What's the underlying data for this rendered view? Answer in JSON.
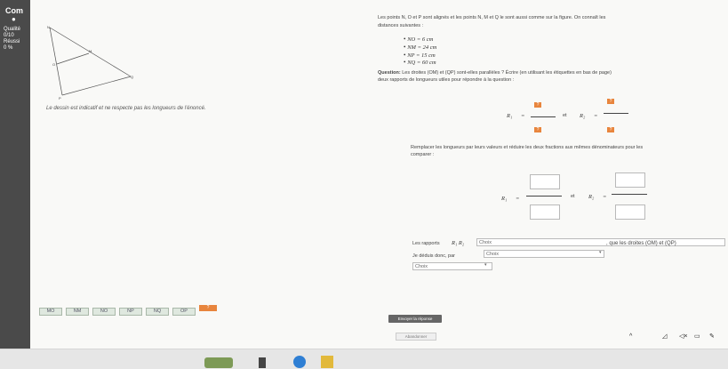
{
  "sidebar": {
    "title": "Com",
    "quality_label": "Qualité",
    "quality_value": "0/10",
    "success_label": "Réussi",
    "success_value": "0 %"
  },
  "figure": {
    "points": {
      "N": "N",
      "P": "P",
      "M": "M",
      "O": "O",
      "Q": "Q"
    },
    "disclaimer": "Le dessin est indicatif et ne respecte pas les longueurs de l'énoncé."
  },
  "statement": {
    "line1": "Les points N, O et P sont alignés et les points N, M et Q le sont aussi comme sur la figure. On connaît les",
    "line2": "distances suivantes :",
    "distances": [
      "NO = 6 cm",
      "NM = 24 cm",
      "NP = 15 cm",
      "NQ = 60 cm"
    ],
    "question_label": "Question:",
    "question": "Les droites (OM) et (QP) sont-elles parallèles ? Écrire (en utilisant les étiquettes en bas de page)",
    "question_line2": "deux rapports de longueurs utiles pour répondre à la question :"
  },
  "ratios1": {
    "r1": "R₁",
    "r2": "R₂",
    "equals": "=",
    "et": "et",
    "placeholder": "?"
  },
  "replace": {
    "line1": "Remplacer les longueurs par leurs valeurs et réduire les deux fractions aux mêmes dénominateurs pour les",
    "line2": "comparer :"
  },
  "ratios2": {
    "r1": "R₁",
    "r2": "R₂",
    "equals": "=",
    "et": "et"
  },
  "conclusion": {
    "line1_prefix": "Les rapports",
    "line1_math": "R₁ R₂",
    "choice1": "Choix",
    "line2_prefix": "Je déduis donc, par",
    "choice2": "Choix",
    "line2_suffix": ", que les droites (OM) et (QP)",
    "choice3": "Choix"
  },
  "labels": [
    "MO",
    "NM",
    "NO",
    "NP",
    "NQ",
    "OP",
    "?"
  ],
  "buttons": {
    "send": "Envoyer la réponse",
    "abandon": "Abandonner"
  },
  "taskbar": {
    "tray": [
      "^",
      "wifi",
      "volume",
      "battery",
      "pen"
    ]
  }
}
